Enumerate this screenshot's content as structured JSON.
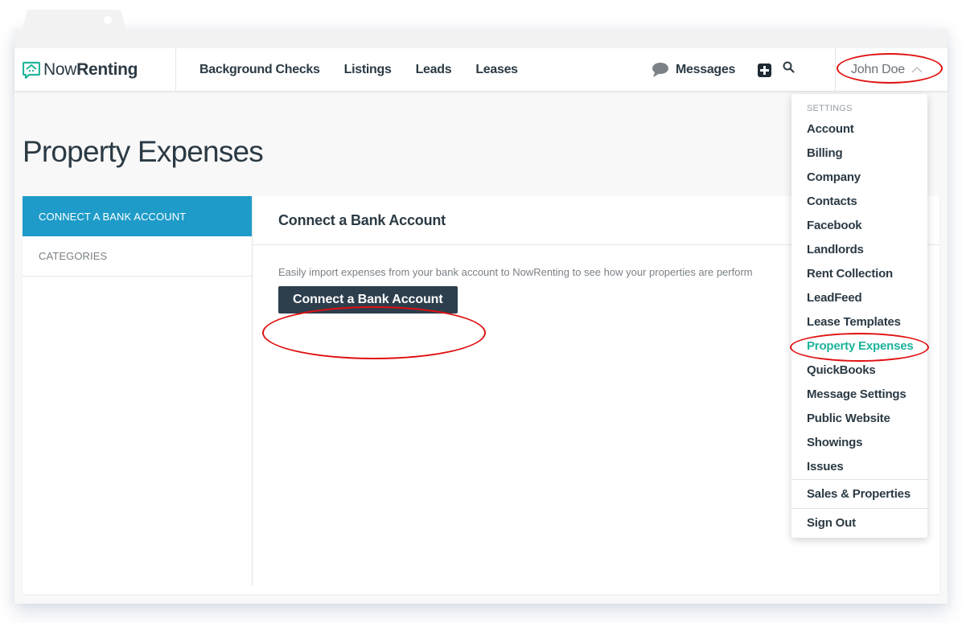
{
  "brand": {
    "now": "Now",
    "renting": "Renting",
    "accent": "#22b59b"
  },
  "nav": {
    "links": [
      "Background Checks",
      "Listings",
      "Leads",
      "Leases"
    ],
    "messages_label": "Messages",
    "user_name": "John Doe"
  },
  "page": {
    "title": "Property Expenses"
  },
  "sidebar": {
    "items": [
      {
        "label": "CONNECT A BANK ACCOUNT",
        "active": true
      },
      {
        "label": "CATEGORIES",
        "active": false
      }
    ],
    "active_color": "#1e9bc9"
  },
  "content": {
    "header": "Connect a Bank Account",
    "description": "Easily import expenses from your bank account to NowRenting to see how your properties are perform",
    "button_label": "Connect a Bank Account"
  },
  "dropdown": {
    "heading": "SETTINGS",
    "items": [
      "Account",
      "Billing",
      "Company",
      "Contacts",
      "Facebook",
      "Landlords",
      "Rent Collection",
      "LeadFeed",
      "Lease Templates",
      "Property Expenses",
      "QuickBooks",
      "Message Settings",
      "Public Website",
      "Showings",
      "Issues"
    ],
    "active_item": "Property Expenses",
    "active_color": "#1eb39b",
    "secondary": "Sales & Properties",
    "sign_out": "Sign Out"
  },
  "annotations": {
    "color": "#e01010"
  }
}
